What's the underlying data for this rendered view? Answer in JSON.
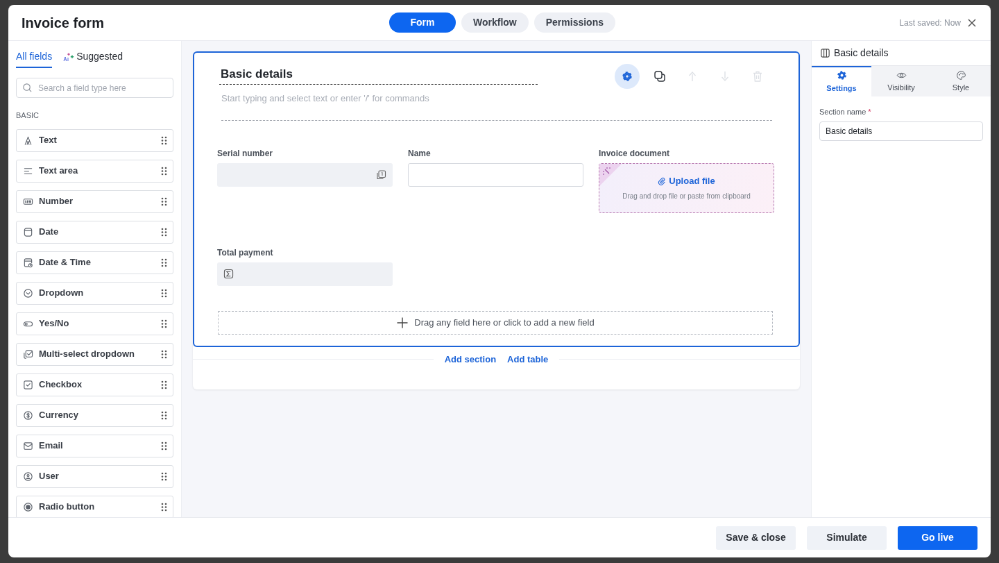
{
  "window": {
    "title": "Invoice form",
    "last_saved": "Last saved: Now"
  },
  "top_tabs": [
    {
      "label": "Form",
      "selected": true
    },
    {
      "label": "Workflow",
      "selected": false
    },
    {
      "label": "Permissions",
      "selected": false
    }
  ],
  "sidebar": {
    "tabs": [
      {
        "label": "All fields",
        "selected": true,
        "kind": "plain"
      },
      {
        "label": "Suggested",
        "selected": false,
        "kind": "ai"
      }
    ],
    "search": {
      "placeholder": "Search a field type here"
    },
    "group": "BASIC",
    "items": [
      {
        "label": "Text",
        "kind": "text"
      },
      {
        "label": "Text area",
        "kind": "textarea"
      },
      {
        "label": "Number",
        "kind": "number"
      },
      {
        "label": "Date",
        "kind": "date"
      },
      {
        "label": "Date & Time",
        "kind": "datetime"
      },
      {
        "label": "Dropdown",
        "kind": "dropdown"
      },
      {
        "label": "Yes/No",
        "kind": "yesno"
      },
      {
        "label": "Multi-select dropdown",
        "kind": "multiselect"
      },
      {
        "label": "Checkbox",
        "kind": "checkbox"
      },
      {
        "label": "Currency",
        "kind": "currency"
      },
      {
        "label": "Email",
        "kind": "email"
      },
      {
        "label": "User",
        "kind": "user"
      },
      {
        "label": "Radio button",
        "kind": "radio"
      }
    ]
  },
  "section": {
    "title": "Basic details",
    "placeholder": "Start typing and select text or enter '/' for commands",
    "toolbar": [
      {
        "kind": "settings",
        "selected": true,
        "disabled": false
      },
      {
        "kind": "duplicate",
        "selected": false,
        "disabled": false
      },
      {
        "kind": "move-up",
        "selected": false,
        "disabled": true
      },
      {
        "kind": "move-down",
        "selected": false,
        "disabled": true
      },
      {
        "kind": "delete",
        "selected": false,
        "disabled": true
      }
    ],
    "fields": [
      {
        "label": "Serial number",
        "kind": "autonumber"
      },
      {
        "label": "Name",
        "kind": "text"
      },
      {
        "label": "Invoice document",
        "kind": "upload",
        "action": "Upload file",
        "hint": "Drag and drop file or paste from clipboard"
      },
      {
        "label": "Total payment",
        "kind": "formula"
      }
    ],
    "dropzone": "Drag any field here or click to add a new field"
  },
  "add_links": [
    "Add section",
    "Add table"
  ],
  "properties": {
    "title": "Basic details",
    "tabs": [
      {
        "label": "Settings",
        "selected": true,
        "kind": "settings"
      },
      {
        "label": "Visibility",
        "selected": false,
        "kind": "visibility"
      },
      {
        "label": "Style",
        "selected": false,
        "kind": "style"
      }
    ],
    "field": {
      "label": "Section name",
      "required": true,
      "required_mark": "*",
      "value": "Basic details"
    }
  },
  "footer": {
    "buttons": [
      {
        "label": "Save & close",
        "kind": "secondary"
      },
      {
        "label": "Simulate",
        "kind": "secondary"
      },
      {
        "label": "Go live",
        "kind": "primary"
      }
    ]
  }
}
